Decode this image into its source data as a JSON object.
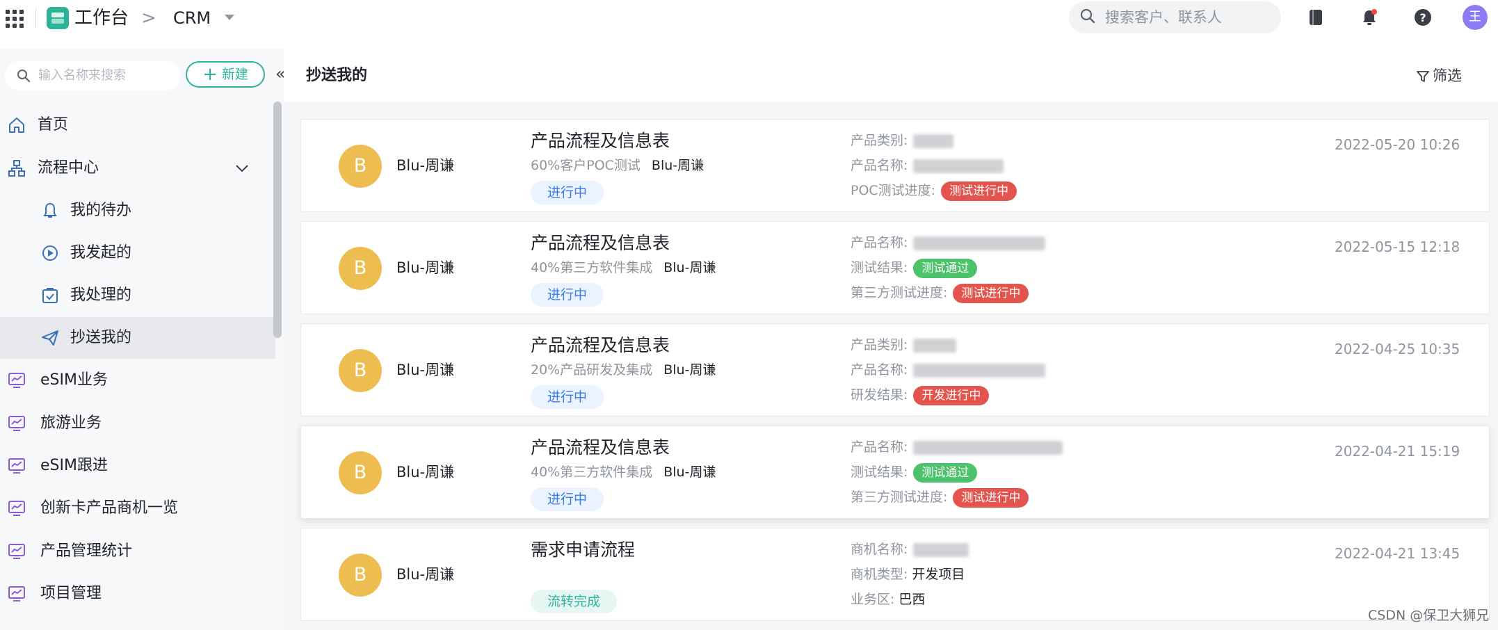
{
  "topbar": {
    "app_name": "工作台",
    "breadcrumb_sep": ">",
    "module": "CRM",
    "search_placeholder": "搜索客户、联系人",
    "user_initial": "王"
  },
  "sidebar": {
    "search_placeholder": "输入名称来搜索",
    "new_button": "新建",
    "items": [
      {
        "label": "首页",
        "icon": "home-icon"
      },
      {
        "label": "流程中心",
        "icon": "process-icon"
      },
      {
        "label": "我的待办",
        "icon": "bell-icon"
      },
      {
        "label": "我发起的",
        "icon": "play-circle-icon"
      },
      {
        "label": "我处理的",
        "icon": "check-box-icon"
      },
      {
        "label": "抄送我的",
        "icon": "send-icon"
      },
      {
        "label": "eSIM业务",
        "icon": "monitor-icon"
      },
      {
        "label": "旅游业务",
        "icon": "monitor-icon"
      },
      {
        "label": "eSIM跟进",
        "icon": "monitor-icon"
      },
      {
        "label": "创新卡产品商机一览",
        "icon": "monitor-icon"
      },
      {
        "label": "产品管理统计",
        "icon": "monitor-icon"
      },
      {
        "label": "项目管理",
        "icon": "monitor-icon"
      }
    ]
  },
  "main": {
    "title": "抄送我的",
    "filter_label": "筛选",
    "cards": [
      {
        "avatar": "B",
        "creator": "Blu-周谦",
        "title": "产品流程及信息表",
        "subtitle": "60%客户POC测试",
        "sub_owner": "Blu-周谦",
        "status": "进行中",
        "f1_label": "产品类别:",
        "f2_label": "产品名称:",
        "f3_label": "POC测试进度:",
        "f3_pill": "测试进行中",
        "time": "2022-05-20 10:26"
      },
      {
        "avatar": "B",
        "creator": "Blu-周谦",
        "title": "产品流程及信息表",
        "subtitle": "40%第三方软件集成",
        "sub_owner": "Blu-周谦",
        "status": "进行中",
        "f1_label": "产品名称:",
        "f2_label": "测试结果:",
        "f2_pill": "测试通过",
        "f3_label": "第三方测试进度:",
        "f3_pill": "测试进行中",
        "time": "2022-05-15 12:18"
      },
      {
        "avatar": "B",
        "creator": "Blu-周谦",
        "title": "产品流程及信息表",
        "subtitle": "20%产品研发及集成",
        "sub_owner": "Blu-周谦",
        "status": "进行中",
        "f1_label": "产品类别:",
        "f2_label": "产品名称:",
        "f3_label": "研发结果:",
        "f3_pill": "开发进行中",
        "time": "2022-04-25 10:35"
      },
      {
        "avatar": "B",
        "creator": "Blu-周谦",
        "title": "产品流程及信息表",
        "subtitle": "40%第三方软件集成",
        "sub_owner": "Blu-周谦",
        "status": "进行中",
        "f1_label": "产品名称:",
        "f2_label": "测试结果:",
        "f2_pill": "测试通过",
        "f3_label": "第三方测试进度:",
        "f3_pill": "测试进行中",
        "time": "2022-04-21 15:19"
      },
      {
        "avatar": "B",
        "creator": "Blu-周谦",
        "title": "需求申请流程",
        "status": "流转完成",
        "f1_label": "商机名称:",
        "f2_label": "商机类型:",
        "f2_value": "开发项目",
        "f3_label": "业务区:",
        "f3_value": "巴西",
        "time": "2022-04-21 13:45"
      }
    ]
  },
  "watermark": "CSDN @保卫大狮兄"
}
